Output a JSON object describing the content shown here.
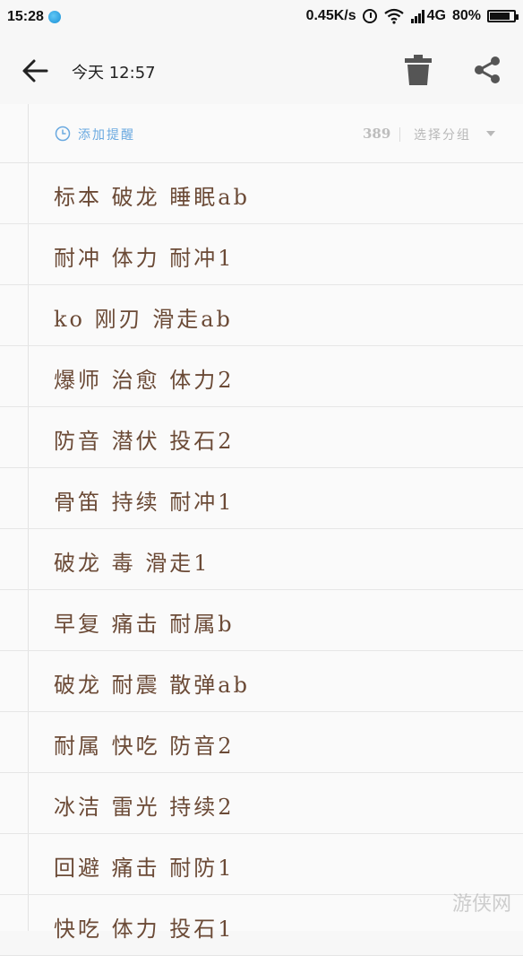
{
  "status_bar": {
    "time": "15:28",
    "speed": "0.45K/s",
    "network": "4G",
    "battery": "80%"
  },
  "toolbar": {
    "title": "今天 12:57"
  },
  "meta": {
    "reminder_label": "添加提醒",
    "count": "389",
    "group_label": "选择分组"
  },
  "lines": [
    "标本 破龙 睡眠ab",
    "耐冲 体力 耐冲1",
    "ko 刚刃 滑走ab",
    "爆师 治愈 体力2",
    "防音 潜伏 投石2",
    "骨笛 持续 耐冲1",
    "破龙 毒 滑走1",
    "早复 痛击 耐属b",
    "破龙 耐震 散弹ab",
    "耐属 快吃 防音2",
    "冰洁 雷光 持续2",
    "回避 痛击 耐防1",
    "快吃 体力 投石1"
  ],
  "watermark": "游侠网",
  "colors": {
    "accent": "#6aa9e0",
    "note_text": "#6b4a36"
  }
}
